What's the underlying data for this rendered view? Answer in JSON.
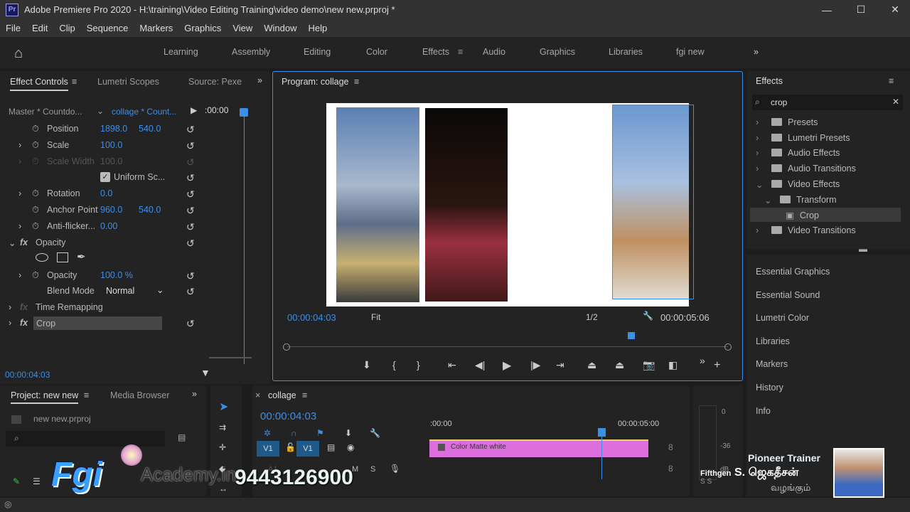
{
  "window": {
    "title": "Adobe Premiere Pro 2020 - H:\\training\\Video Editing Training\\video demo\\new new.prproj *",
    "app_icon": "Pr",
    "minimize": "—",
    "maximize": "☐",
    "close": "✕"
  },
  "menu": [
    "File",
    "Edit",
    "Clip",
    "Sequence",
    "Markers",
    "Graphics",
    "View",
    "Window",
    "Help"
  ],
  "workspaces": [
    "Learning",
    "Assembly",
    "Editing",
    "Color",
    "Effects",
    "Audio",
    "Graphics",
    "Libraries",
    "fgi new"
  ],
  "active_workspace": "Effects",
  "effect_controls": {
    "tabs": [
      "Effect Controls",
      "Lumetri Scopes",
      "Source: Pexe"
    ],
    "master": "Master * Countdo...",
    "clip": "collage * Count...",
    "ruler_time": ":00:00",
    "rows": [
      {
        "label": "Position",
        "v1": "1898.0",
        "v2": "540.0"
      },
      {
        "label": "Scale",
        "v1": "100.0"
      },
      {
        "label": "Scale Width",
        "v1": "100.0"
      },
      {
        "label": "Uniform Sc..."
      },
      {
        "label": "Rotation",
        "v1": "0.0"
      },
      {
        "label": "Anchor Point",
        "v1": "960.0",
        "v2": "540.0"
      },
      {
        "label": "Anti-flicker...",
        "v1": "0.00"
      }
    ],
    "opacity_section": "Opacity",
    "opacity_label": "Opacity",
    "opacity_value": "100.0 %",
    "blend_label": "Blend Mode",
    "blend_value": "Normal",
    "time_remap": "Time Remapping",
    "crop": "Crop",
    "fx": "fx",
    "timecode": "00:00:04:03"
  },
  "program": {
    "title": "Program: collage",
    "timecode": "00:00:04:03",
    "fit": "Fit",
    "resolution": "1/2",
    "duration": "00:00:05:06",
    "playhead_fraction": 0.78
  },
  "effects": {
    "title": "Effects",
    "search": "crop",
    "tree": [
      {
        "label": "Presets",
        "level": 0
      },
      {
        "label": "Lumetri Presets",
        "level": 0
      },
      {
        "label": "Audio Effects",
        "level": 0
      },
      {
        "label": "Audio Transitions",
        "level": 0
      },
      {
        "label": "Video Effects",
        "level": 0
      },
      {
        "label": "Transform",
        "level": 1
      },
      {
        "label": "Crop",
        "level": 2
      },
      {
        "label": "Video Transitions",
        "level": 0
      }
    ]
  },
  "right_panels": [
    "Essential Graphics",
    "Essential Sound",
    "Lumetri Color",
    "Libraries",
    "Markers",
    "History",
    "Info"
  ],
  "project": {
    "tabs": [
      "Project: new new",
      "Media Browser"
    ],
    "file": "new new.prproj"
  },
  "timeline": {
    "tab": "collage",
    "timecode": "00:00:04:03",
    "ruler": [
      ":00:00",
      "00:00:05:00"
    ],
    "track_v": "V1",
    "track_a": "A1",
    "clip": "Color Matte white",
    "m": "M",
    "s": "S",
    "clip_color": "#dc6fdc"
  },
  "meters": {
    "labels": [
      "0",
      "-36",
      "dB"
    ],
    "solo": "S S"
  },
  "overlay": {
    "brand": "Fgi",
    "academy": "Academy.in",
    "phone": "9443126900",
    "trainer_title": "Pioneer Trainer",
    "trainer_name": "S. ஜெகதீசன்",
    "presents": "வழங்கும்",
    "fifthgen": "Fifthgen"
  }
}
